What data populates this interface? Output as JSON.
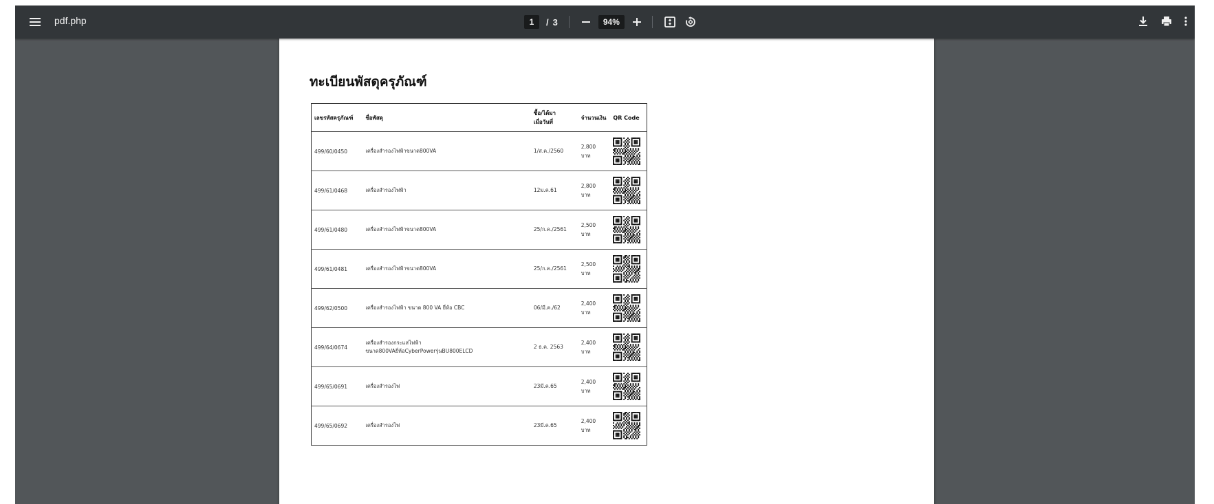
{
  "viewer": {
    "file_name": "pdf.php",
    "current_page": "1",
    "page_separator": "/",
    "total_pages": "3",
    "zoom": "94%"
  },
  "icons": {
    "menu": "hamburger-icon",
    "zoom_out": "minus-icon",
    "zoom_in": "plus-icon",
    "fit_page": "fit-page-icon",
    "rotate": "rotate-icon",
    "download": "download-icon",
    "print": "print-icon",
    "more": "more-vert-icon"
  },
  "colors": {
    "toolbar_bg": "#323639",
    "viewer_bg": "#525659",
    "page_bg": "#ffffff"
  },
  "document": {
    "title": "ทะเบียนพัสดุครุภัณฑ์",
    "headers": {
      "id": "เลขรหัสครุภัณฑ์",
      "name": "ชื่อพัสดุ",
      "date_line1": "ซื้อ/ได้มา",
      "date_line2": "เมื่อวันที่",
      "amount": "จำนวนเงิน",
      "qr": "QR Code"
    },
    "rows": [
      {
        "id": "499/60/0450",
        "name": "เครื่องสำรองไฟฟ้าขนาด800VA",
        "date": "1/ส.ค./2560",
        "amount": "2,800",
        "unit": "บาท"
      },
      {
        "id": "499/61/0468",
        "name": "เครื่องสำรองไฟฟ้า",
        "date": "12ม.ค.61",
        "amount": "2,800",
        "unit": "บาท"
      },
      {
        "id": "499/61/0480",
        "name": "เครื่องสำรองไฟฟ้าขนาด800VA",
        "date": "25/ก.ค./2561",
        "amount": "2,500",
        "unit": "บาท"
      },
      {
        "id": "499/61/0481",
        "name": "เครื่องสำรองไฟฟ้าขนาด800VA",
        "date": "25/ก.ค./2561",
        "amount": "2,500",
        "unit": "บาท"
      },
      {
        "id": "499/62/0500",
        "name": "เครื่องสำรองไฟฟ้า ขนาด 800 VA ยี่ห้อ CBC",
        "date": "06/มี.ค./62",
        "amount": "2,400",
        "unit": "บาท"
      },
      {
        "id": "499/64/0674",
        "name": "เครื่องสำรองกระแสไฟฟ้าขนาด800VAยี่ห้อCyberPowerรุ่นBU800ELCD",
        "date": "2 ธ.ค. 2563",
        "amount": "2,400",
        "unit": "บาท"
      },
      {
        "id": "499/65/0691",
        "name": "เครื่องสำรองไฟ",
        "date": "23มี.ค.65",
        "amount": "2,400",
        "unit": "บาท"
      },
      {
        "id": "499/65/0692",
        "name": "เครื่องสำรองไฟ",
        "date": "23มี.ค.65",
        "amount": "2,400",
        "unit": "บาท"
      }
    ]
  }
}
